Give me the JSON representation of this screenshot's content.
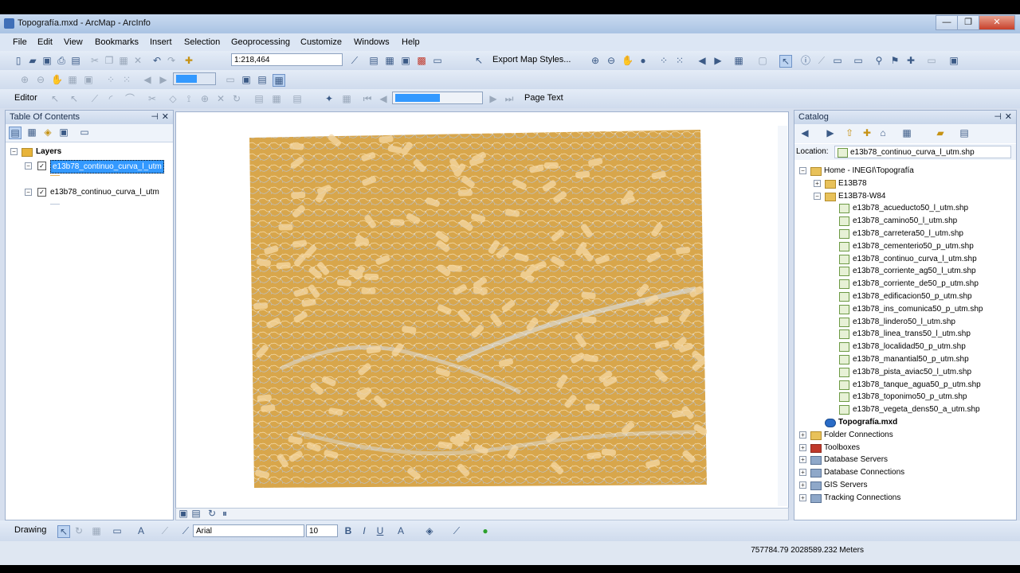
{
  "window": {
    "title": "Topografía.mxd - ArcMap - ArcInfo"
  },
  "menu": [
    "File",
    "Edit",
    "View",
    "Bookmarks",
    "Insert",
    "Selection",
    "Geoprocessing",
    "Customize",
    "Windows",
    "Help"
  ],
  "toolbar": {
    "scale": "1:218,464",
    "export_styles": "Export Map Styles...",
    "page_text": "Page Text",
    "editor": "Editor"
  },
  "toc": {
    "title": "Table Of Contents",
    "root": "Layers",
    "layers": [
      "e13b78_continuo_curva_l_utm",
      "e13b78_continuo_curva_l_utm"
    ]
  },
  "catalog": {
    "title": "Catalog",
    "location_label": "Location:",
    "location_value": "e13b78_continuo_curva_l_utm.shp",
    "home": "Home - INEGI\\Topografía",
    "folders": [
      "E13B78",
      "E13B78-W84"
    ],
    "files": [
      "e13b78_acueducto50_l_utm.shp",
      "e13b78_camino50_l_utm.shp",
      "e13b78_carretera50_l_utm.shp",
      "e13b78_cementerio50_p_utm.shp",
      "e13b78_continuo_curva_l_utm.shp",
      "e13b78_corriente_ag50_l_utm.shp",
      "e13b78_corriente_de50_p_utm.shp",
      "e13b78_edificacion50_p_utm.shp",
      "e13b78_ins_comunica50_p_utm.shp",
      "e13b78_lindero50_l_utm.shp",
      "e13b78_linea_trans50_l_utm.shp",
      "e13b78_localidad50_p_utm.shp",
      "e13b78_manantial50_p_utm.shp",
      "e13b78_pista_aviac50_l_utm.shp",
      "e13b78_tanque_agua50_p_utm.shp",
      "e13b78_toponimo50_p_utm.shp",
      "e13b78_vegeta_dens50_a_utm.shp"
    ],
    "mxd": "Topografía.mxd",
    "other": [
      "Folder Connections",
      "Toolboxes",
      "Database Servers",
      "Database Connections",
      "GIS Servers",
      "Tracking Connections"
    ]
  },
  "drawing": {
    "label": "Drawing",
    "font": "Arial",
    "size": "10"
  },
  "status": {
    "coords": "757784.79  2028589.232 Meters"
  },
  "colors": {
    "map_fill": "#d9a94f",
    "contour": "#e8b45c",
    "highlight": "#3399ff"
  }
}
